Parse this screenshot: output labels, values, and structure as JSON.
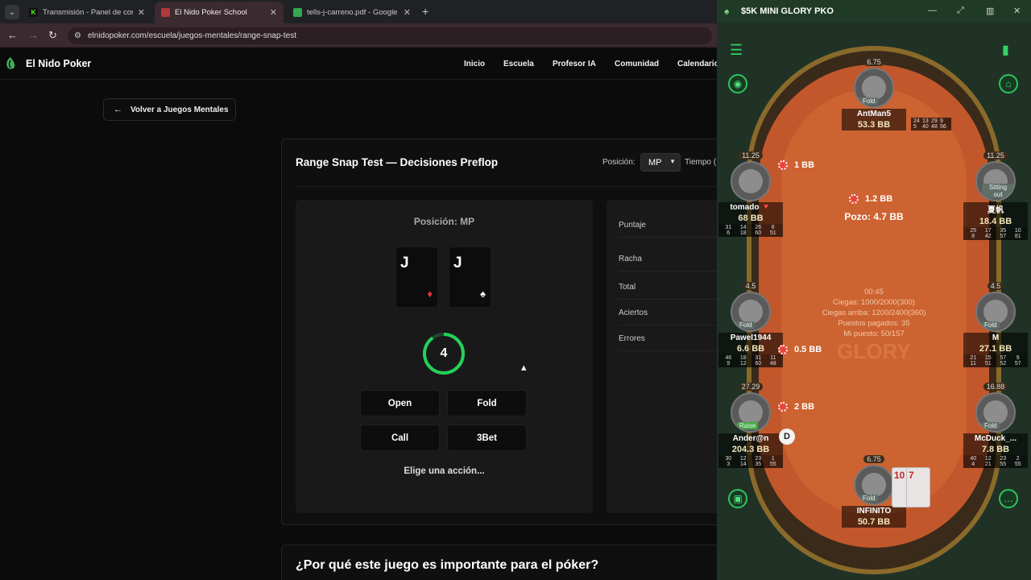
{
  "browser": {
    "tabs": [
      {
        "title": "Transmisión - Panel de control",
        "active": false
      },
      {
        "title": "El Nido Poker School",
        "active": true
      },
      {
        "title": "tells-j-carreno.pdf - Google Drive",
        "active": false
      }
    ],
    "url": "elnidopoker.com/escuela/juegos-mentales/range-snap-test"
  },
  "site": {
    "brand": "El Nido Poker",
    "nav": [
      "Inicio",
      "Escuela",
      "Profesor IA",
      "Comunidad",
      "Calendario"
    ],
    "back_label": "Volver a Juegos Mentales",
    "panel": {
      "title": "Range Snap Test — Decisiones Preflop",
      "position_label": "Posición:",
      "position_value": "MP",
      "time_label": "Tiempo (",
      "game_position": "Posición: MP",
      "cards": [
        {
          "rank": "J",
          "suit": "♦",
          "suit_color": "#e0323a"
        },
        {
          "rank": "J",
          "suit": "♠",
          "suit_color": "#ffffff"
        }
      ],
      "timer": "4",
      "timer_fraction": 0.9,
      "actions": [
        "Open",
        "Fold",
        "Call",
        "3Bet"
      ],
      "prompt": "Elige una acción...",
      "stats": [
        "Puntaje",
        "Racha",
        "Total",
        "Aciertos",
        "Errores"
      ]
    },
    "why_title": "¿Por qué este juego es importante para el póker?"
  },
  "poker": {
    "title": "$5K MINI GLORY PKO",
    "seats": [
      {
        "name": "AntMan5",
        "stack": "53.3 BB",
        "bounty": "6.75",
        "tag": "Fold",
        "stats": [
          "24",
          "13",
          "29",
          "9",
          "5",
          "40",
          "48",
          "56"
        ]
      },
      {
        "name": "tomado 🔻",
        "stack": "68 BB",
        "bounty": "11.25",
        "tag": "",
        "stats": [
          "31",
          "14",
          "26",
          "6",
          "6",
          "18",
          "60",
          "51"
        ]
      },
      {
        "name": "夏帆",
        "stack": "18.4 BB",
        "bounty": "11.25",
        "tag": "Sitting out",
        "stats": [
          "25",
          "17",
          "35",
          "10",
          "8",
          "42",
          "57",
          "81"
        ]
      },
      {
        "name": "Pawel1944",
        "stack": "6.6 BB",
        "bounty": "4.5",
        "tag": "Fold",
        "stats": [
          "46",
          "18",
          "31",
          "11",
          "9",
          "12",
          "60",
          "48"
        ]
      },
      {
        "name": "M",
        "stack": "27.1 BB",
        "bounty": "4.5",
        "tag": "Fold",
        "stats": [
          "21",
          "15",
          "57",
          "9",
          "11",
          "51",
          "52",
          "57"
        ]
      },
      {
        "name": "Ander@n",
        "stack": "204.3 BB",
        "bounty": "27.29",
        "tag": "Raise",
        "stats": [
          "30",
          "12",
          "23",
          "1",
          "3",
          "14",
          "35",
          "55"
        ]
      },
      {
        "name": "McDuck_...",
        "stack": "7.8 BB",
        "bounty": "16.88",
        "tag": "Fold",
        "stats": [
          "40",
          "12",
          "23",
          "2",
          "4",
          "21",
          "55",
          "55"
        ]
      },
      {
        "name": "INFINITO",
        "stack": "50.7 BB",
        "bounty": "6.75",
        "tag": "Fold",
        "stats": []
      }
    ],
    "bets": [
      "1 BB",
      "1.2 BB",
      "0.5 BB",
      "2 BB"
    ],
    "pot": "Pozo: 4.7 BB",
    "info": [
      "00:45",
      "Ciegas: 1000/2000(300)",
      "Ciegas arriba: 1200/2400(360)",
      "Puestos pagados: 35",
      "Mi puesto: 50/157"
    ],
    "watermark": "GLORY",
    "dealer": "D",
    "hero_cards": [
      "10",
      "7"
    ]
  }
}
